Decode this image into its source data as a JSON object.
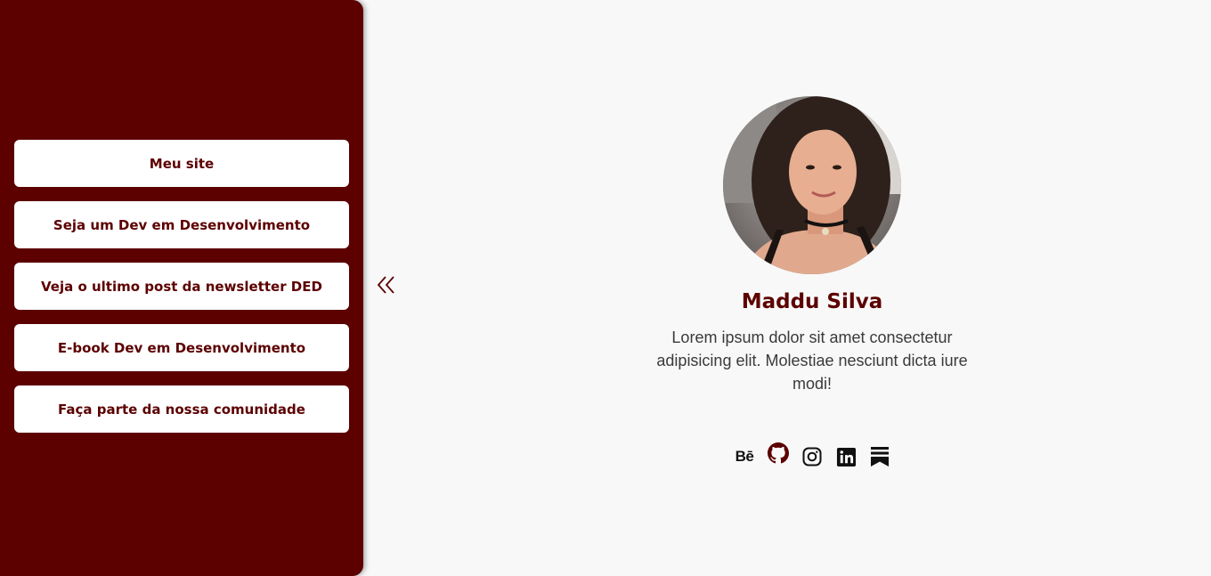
{
  "sidebar": {
    "links": [
      {
        "label": "Meu site"
      },
      {
        "label": "Seja um Dev em Desenvolvimento"
      },
      {
        "label": "Veja o ultimo post da newsletter DED"
      },
      {
        "label": "E-book Dev em Desenvolvimento"
      },
      {
        "label": "Faça parte da nossa comunidade"
      }
    ]
  },
  "toggle": {
    "icon": "double-chevron-left-icon"
  },
  "profile": {
    "name": "Maddu Silva",
    "bio": "Lorem ipsum dolor sit amet consectetur adipisicing elit. Molestiae nesciunt dicta iure modi!",
    "avatar_icon": "profile-photo"
  },
  "socials": {
    "behance_text": "Bē",
    "icons": [
      "behance-icon",
      "github-icon",
      "instagram-icon",
      "linkedin-icon",
      "substack-icon"
    ]
  },
  "colors": {
    "brand": "#5c0000",
    "background": "#f8f8f8",
    "button_bg": "#ffffff"
  }
}
